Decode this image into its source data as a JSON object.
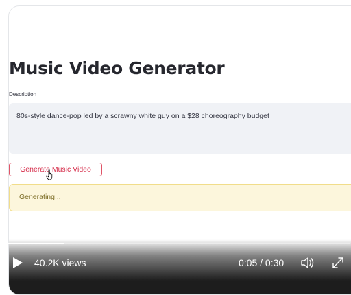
{
  "app": {
    "title": "Music Video Generator",
    "description_label": "Description",
    "description_value": "80s-style dance-pop led by a scrawny white guy on a $28 choreography budget",
    "generate_button_label": "Generate Music Video",
    "status_text": "Generating..."
  },
  "player": {
    "views": "40.2K views",
    "time": "0:05 / 0:30",
    "progress_fraction": 0.1667,
    "icons": {
      "play": "play-icon",
      "volume": "volume-icon",
      "expand": "expand-icon"
    }
  },
  "colors": {
    "accent": "#d62f4c",
    "status_bg": "#fcf6dc",
    "input_bg": "#f0f2f6"
  }
}
